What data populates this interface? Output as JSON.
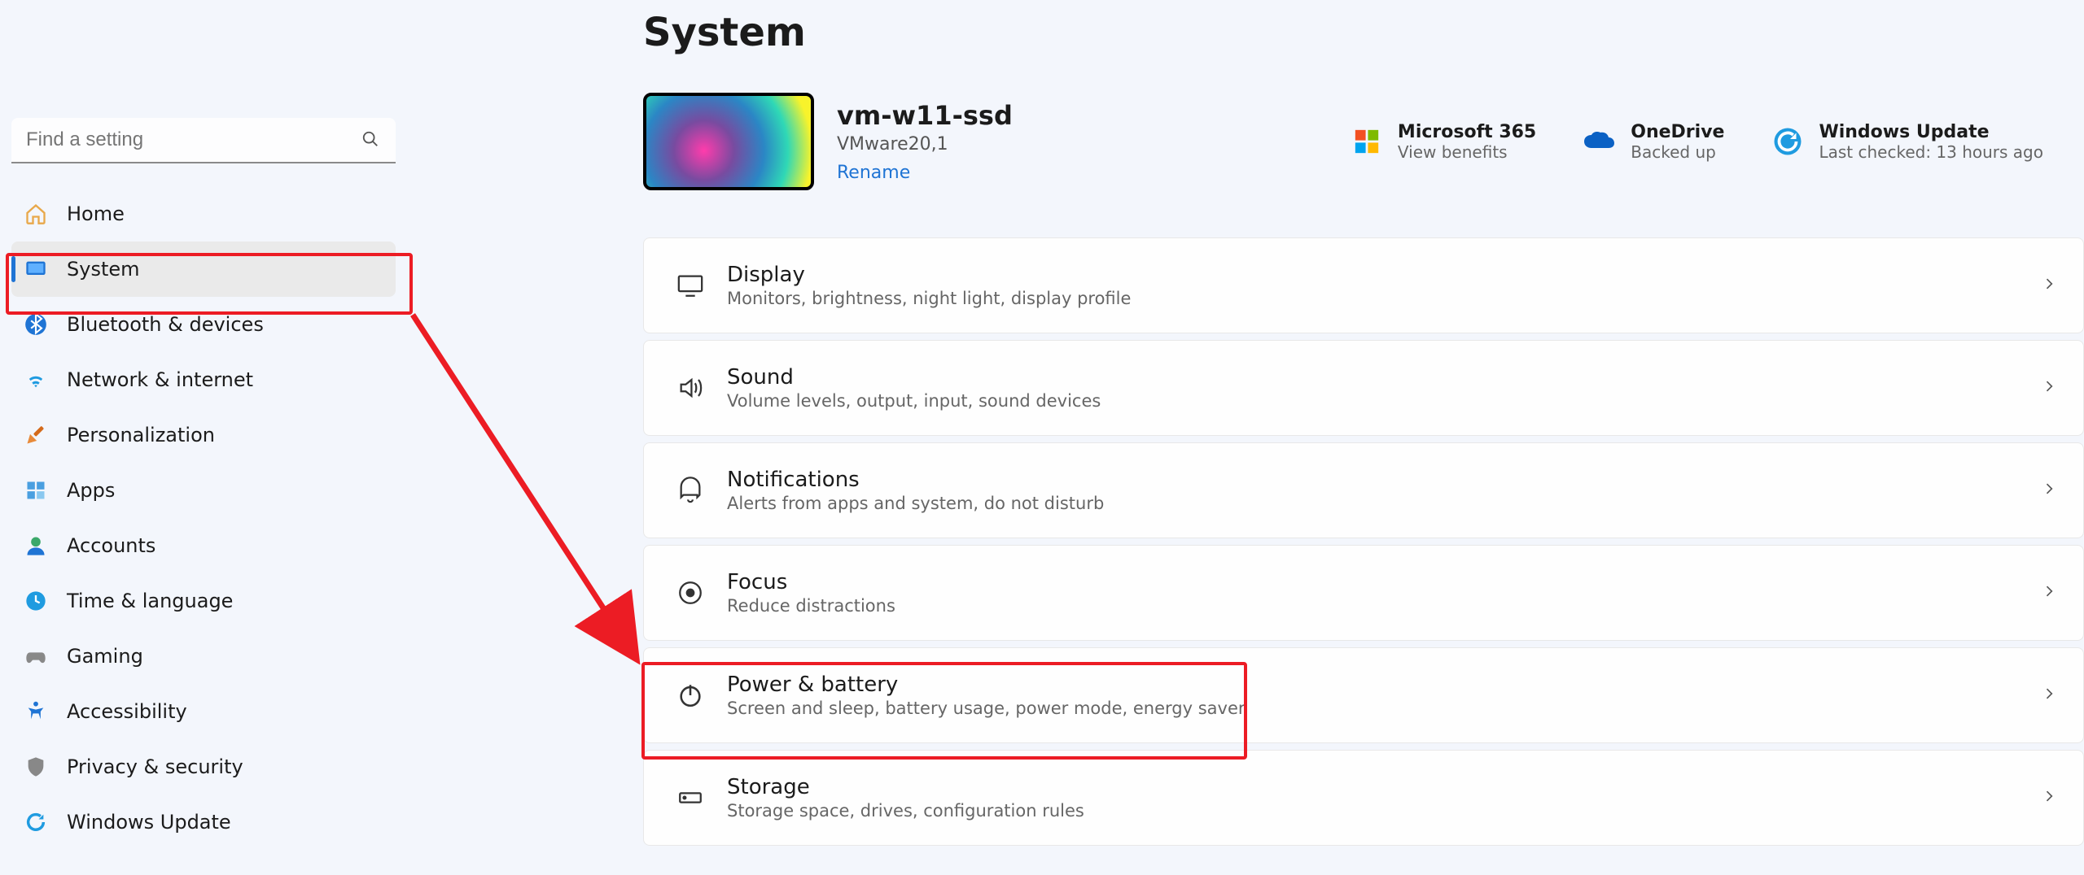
{
  "page": {
    "title": "System"
  },
  "search": {
    "placeholder": "Find a setting"
  },
  "nav": [
    {
      "label": "Home"
    },
    {
      "label": "System"
    },
    {
      "label": "Bluetooth & devices"
    },
    {
      "label": "Network & internet"
    },
    {
      "label": "Personalization"
    },
    {
      "label": "Apps"
    },
    {
      "label": "Accounts"
    },
    {
      "label": "Time & language"
    },
    {
      "label": "Gaming"
    },
    {
      "label": "Accessibility"
    },
    {
      "label": "Privacy & security"
    },
    {
      "label": "Windows Update"
    }
  ],
  "device": {
    "name": "vm-w11-ssd",
    "model": "VMware20,1",
    "rename": "Rename"
  },
  "cloud": {
    "m365": {
      "title": "Microsoft 365",
      "sub": "View benefits"
    },
    "onedrive": {
      "title": "OneDrive",
      "sub": "Backed up"
    },
    "update": {
      "title": "Windows Update",
      "sub": "Last checked: 13 hours ago"
    }
  },
  "settings": [
    {
      "title": "Display",
      "sub": "Monitors, brightness, night light, display profile"
    },
    {
      "title": "Sound",
      "sub": "Volume levels, output, input, sound devices"
    },
    {
      "title": "Notifications",
      "sub": "Alerts from apps and system, do not disturb"
    },
    {
      "title": "Focus",
      "sub": "Reduce distractions"
    },
    {
      "title": "Power & battery",
      "sub": "Screen and sleep, battery usage, power mode, energy saver"
    },
    {
      "title": "Storage",
      "sub": "Storage space, drives, configuration rules"
    }
  ]
}
